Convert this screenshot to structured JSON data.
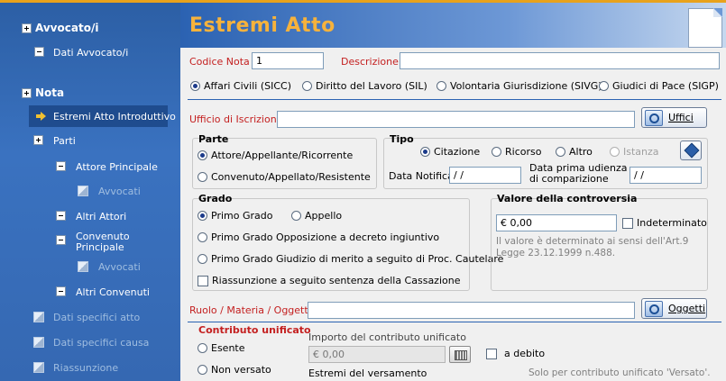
{
  "sidebar": {
    "avvocati": "Avvocato/i",
    "dati_avvocati": "Dati Avvocato/i",
    "nota": "Nota",
    "estremi_atto": "Estremi Atto Introduttivo",
    "parti": "Parti",
    "attore_principale": "Attore Principale",
    "avvocati_1": "Avvocati",
    "altri_attori": "Altri Attori",
    "convenuto_principale": "Convenuto Principale",
    "avvocati_2": "Avvocati",
    "altri_convenuti": "Altri Convenuti",
    "dati_specifici_atto": "Dati specifici atto",
    "dati_specifici_causa": "Dati specifici causa",
    "riassunzione": "Riassunzione"
  },
  "header": {
    "title": "Estremi Atto"
  },
  "codice": {
    "label": "Codice Nota",
    "value": "1",
    "descr_label": "Descrizione",
    "descr_value": ""
  },
  "tipo_atto": {
    "options": [
      "Affari Civili (SICC)",
      "Diritto del Lavoro (SIL)",
      "Volontaria Giurisdizione (SIVG)",
      "Giudici di Pace (SIGP)"
    ],
    "selected": "Affari Civili (SICC)"
  },
  "ufficio": {
    "label": "Ufficio di Iscrizione",
    "value": "",
    "button": "Uffici"
  },
  "parte": {
    "title": "Parte",
    "options": [
      "Attore/Appellante/Ricorrente",
      "Convenuto/Appellato/Resistente"
    ],
    "selected": "Attore/Appellante/Ricorrente"
  },
  "tipo": {
    "title": "Tipo",
    "options": [
      "Citazione",
      "Ricorso",
      "Altro",
      "Istanza"
    ],
    "selected": "Citazione",
    "data_notifica_label": "Data Notifica",
    "data_notifica": " /  /",
    "data_udienza_label": "Data prima udienza di comparizione",
    "data_udienza": " /  /"
  },
  "grado": {
    "title": "Grado",
    "options": [
      "Primo Grado",
      "Appello",
      "Primo Grado Opposizione a decreto ingiuntivo",
      "Primo Grado Giudizio di merito a seguito di Proc. Cautelare"
    ],
    "selected": "Primo Grado",
    "riassunzione_label": "Riassunzione a seguito sentenza della Cassazione"
  },
  "valore": {
    "title": "Valore della controversia",
    "value": "€ 0,00",
    "indeterminato_label": "Indeterminato",
    "note": "Il valore è determinato ai sensi dell'Art.9 Legge 23.12.1999 n.488."
  },
  "ruolo": {
    "label": "Ruolo / Materia / Oggetto",
    "value": "",
    "button": "Oggetti"
  },
  "contributo": {
    "title": "Contributo unificato",
    "options": [
      "Esente",
      "Non versato"
    ],
    "importo_label": "Importo del contributo unificato",
    "importo_value": "€ 0,00",
    "a_debito_label": "a debito",
    "estremi_label": "Estremi del versamento",
    "note": "Solo per contributo unificato 'Versato'."
  },
  "colors": {
    "accent_orange": "#e8a21c",
    "sidebar_blue": "#3568b2",
    "label_red": "#c42020"
  }
}
